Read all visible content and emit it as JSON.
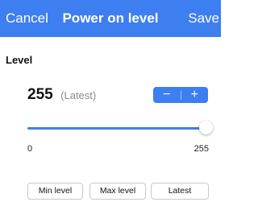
{
  "header": {
    "cancel_label": "Cancel",
    "title": "Power on level",
    "save_label": "Save"
  },
  "level": {
    "section_label": "Level",
    "value": "255",
    "value_note": "(Latest)",
    "decrement_symbol": "−",
    "increment_symbol": "+",
    "slider": {
      "min": 0,
      "max": 255,
      "current": 255,
      "min_label": "0",
      "max_label": "255"
    }
  },
  "actions": {
    "min_label": "Min level",
    "max_label": "Max level",
    "latest_label": "Latest"
  },
  "colors": {
    "accent": "#3d7ef0"
  }
}
